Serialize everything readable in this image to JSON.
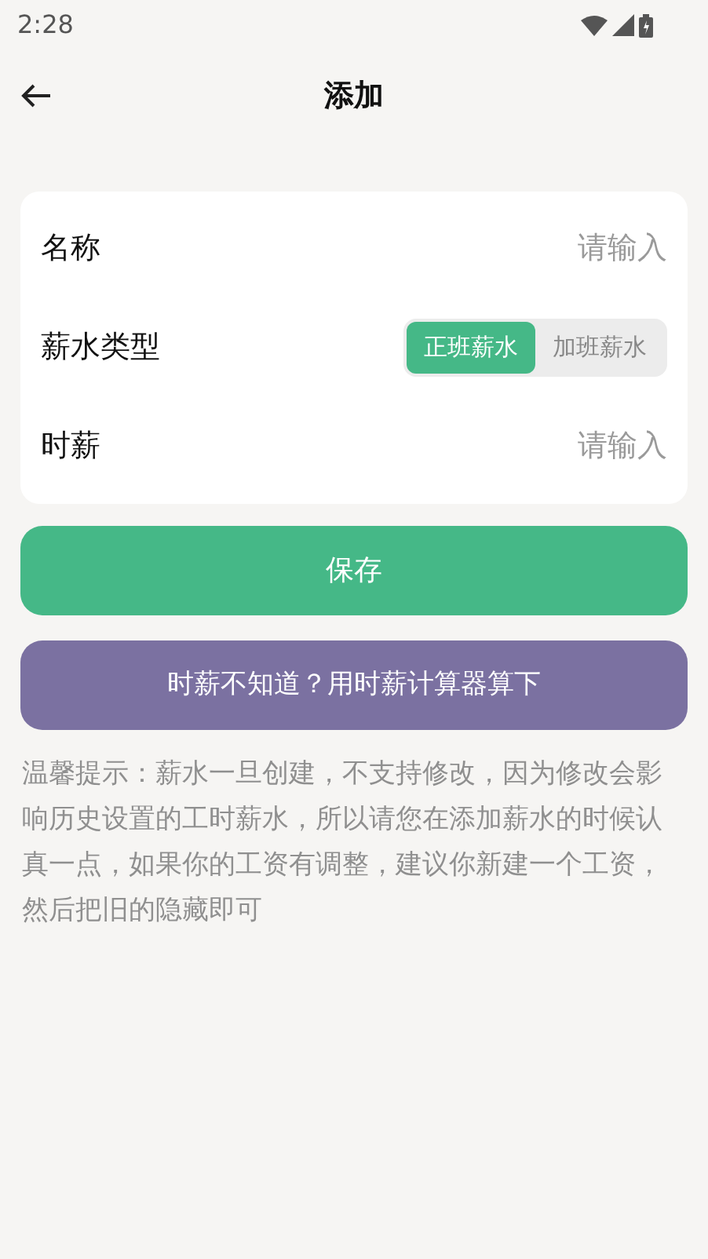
{
  "status_bar": {
    "time": "2:28"
  },
  "header": {
    "title": "添加"
  },
  "form": {
    "rows": [
      {
        "kind": "input",
        "label": "名称",
        "placeholder": "请输入"
      },
      {
        "kind": "segment",
        "label": "薪水类型",
        "options": [
          {
            "label": "正班薪水",
            "selected": true
          },
          {
            "label": "加班薪水",
            "selected": false
          }
        ]
      },
      {
        "kind": "input",
        "label": "时薪",
        "placeholder": "请输入"
      }
    ]
  },
  "save_button": "保存",
  "calculator_button": "时薪不知道？用时薪计算器算下",
  "tip": "温馨提示：薪水一旦创建，不支持修改，因为修改会影响历史设置的工时薪水，所以请您在添加薪水的时候认真一点，如果你的工资有调整，建议你新建一个工资，然后把旧的隐藏即可"
}
